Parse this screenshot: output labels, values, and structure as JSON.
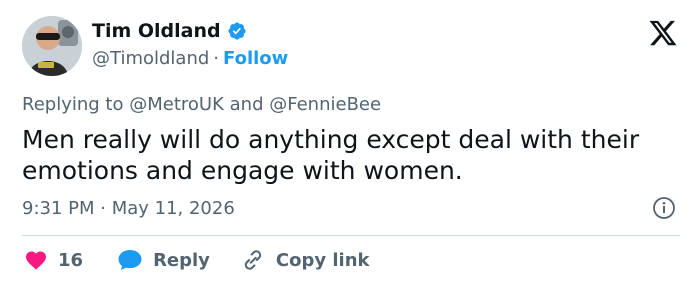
{
  "header": {
    "name": "Tim Oldland",
    "handle": "@Timoldland",
    "separator": "·",
    "follow_label": "Follow"
  },
  "tweet": {
    "replying_prefix": "Replying to",
    "reply_to_1": "@MetroUK",
    "reply_join": "and",
    "reply_to_2": "@FennieBee",
    "text": "Men really will do anything except deal with their emotions and engage with women.",
    "timestamp": "9:31 PM · May 11, 2026"
  },
  "actions": {
    "like_count": "16",
    "reply_label": "Reply",
    "copy_link_label": "Copy link"
  },
  "colors": {
    "accent": "#1d9bf0",
    "like": "#f91880",
    "muted": "#536471",
    "text": "#0f1419"
  },
  "icons": {
    "verified": "verified-badge-icon",
    "logo": "x-logo-icon",
    "info": "info-icon",
    "like": "heart-icon",
    "reply": "speech-bubble-icon",
    "copy": "link-icon"
  }
}
